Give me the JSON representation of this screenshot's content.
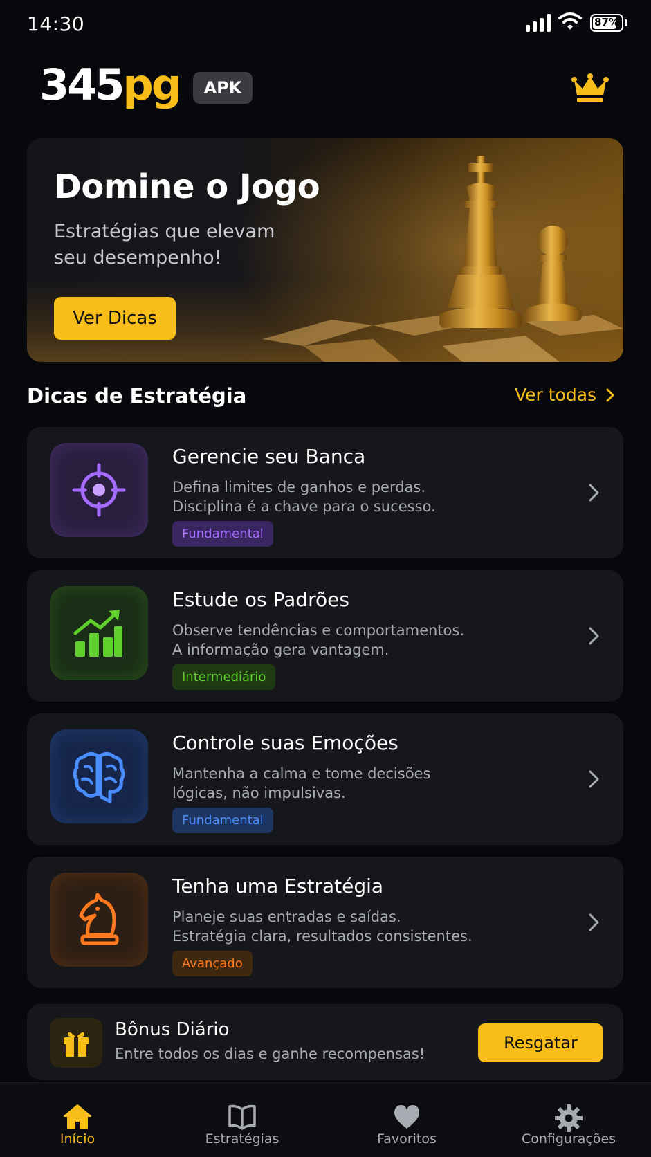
{
  "status_bar": {
    "time": "14:30",
    "battery_text": "87%",
    "battery_level": 0.87,
    "icons": [
      "signal-icon",
      "wifi-icon",
      "battery-icon"
    ]
  },
  "header": {
    "brand_number": "345",
    "brand_suffix": "pg",
    "badge": "APK",
    "action_icon": "crown-icon"
  },
  "hero": {
    "title": "Domine o Jogo",
    "subtitle": "Estratégias que elevam seu desempenho!",
    "cta_label": "Ver Dicas",
    "illustration": "chess-king-and-pawn"
  },
  "tips_section": {
    "title": "Dicas de Estratégia",
    "see_all_label": "Ver todas"
  },
  "tips": [
    {
      "icon": "target-icon",
      "title": "Gerencie seu Banca",
      "desc_line1": "Defina limites de ganhos e perdas.",
      "desc_line2": "Disciplina é a chave para o sucesso.",
      "badge": "Fundamental",
      "accent": "#a66bff",
      "badge_bg": "#3a2660",
      "icon_bg": "#2a1f3f"
    },
    {
      "icon": "chart-growth-icon",
      "title": "Estude os Padrões",
      "desc_line1": "Observe tendências e comportamentos.",
      "desc_line2": "A informação gera vantagem.",
      "badge": "Intermediário",
      "accent": "#5fcf2c",
      "badge_bg": "#1f3a12",
      "icon_bg": "#1a2e17"
    },
    {
      "icon": "brain-icon",
      "title": "Controle suas Emoções",
      "desc_line1": "Mantenha a calma e tome decisões",
      "desc_line2": "lógicas, não impulsivas.",
      "badge": "Fundamental",
      "accent": "#4a8dff",
      "badge_bg": "#1d3560",
      "icon_bg": "#16264a"
    },
    {
      "icon": "chess-knight-icon",
      "title": "Tenha uma Estratégia",
      "desc_line1": "Planeje suas entradas e saídas.",
      "desc_line2": "Estratégia clara, resultados consistentes.",
      "badge": "Avançado",
      "accent": "#ff7a1f",
      "badge_bg": "#3f2810",
      "icon_bg": "#2e1f14"
    }
  ],
  "bonus": {
    "icon": "gift-icon",
    "title": "Bônus Diário",
    "subtitle": "Entre todos os dias e ganhe recompensas!",
    "button_label": "Resgatar"
  },
  "bottom_nav": {
    "items": [
      {
        "label": "Início",
        "icon": "home-icon",
        "active": true
      },
      {
        "label": "Estratégias",
        "icon": "book-icon",
        "active": false
      },
      {
        "label": "Favoritos",
        "icon": "heart-icon",
        "active": false
      },
      {
        "label": "Configurações",
        "icon": "gear-icon",
        "active": false
      }
    ]
  },
  "colors": {
    "background": "#07080b",
    "card": "#15171b",
    "accent": "#f8bd19",
    "muted_text": "#a9abb2"
  }
}
